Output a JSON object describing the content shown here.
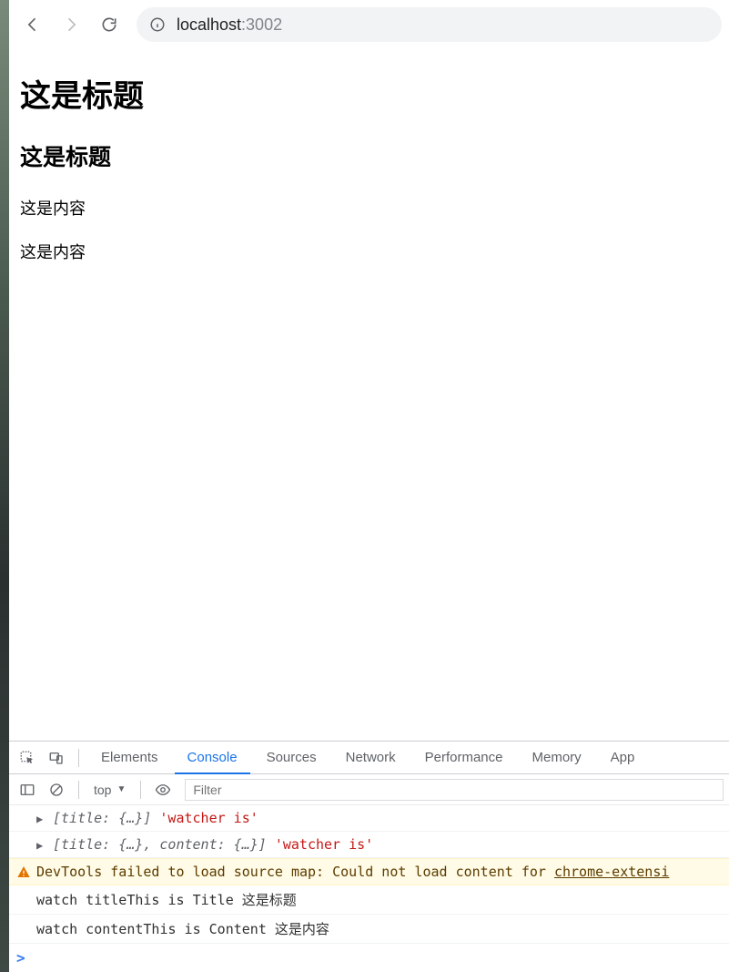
{
  "browser": {
    "url_host": "localhost",
    "url_port": ":3002"
  },
  "page": {
    "h1": "这是标题",
    "h2": "这是标题",
    "p1": "这是内容",
    "p2": "这是内容"
  },
  "devtools": {
    "tabs": {
      "elements": "Elements",
      "console": "Console",
      "sources": "Sources",
      "network": "Network",
      "performance": "Performance",
      "memory": "Memory",
      "application": "App"
    },
    "toolbar": {
      "context": "top",
      "filter_placeholder": "Filter"
    },
    "console": {
      "row1_obj": "[title: {…}]",
      "row1_str": "'watcher is'",
      "row2_obj": "[title: {…}, content: {…}]",
      "row2_str": "'watcher is'",
      "warn_prefix": "DevTools failed to load source map: Could not load content for ",
      "warn_link": "chrome-extensi",
      "row4": "watch titleThis is Title 这是标题",
      "row5": "watch contentThis is Content 这是内容"
    }
  }
}
